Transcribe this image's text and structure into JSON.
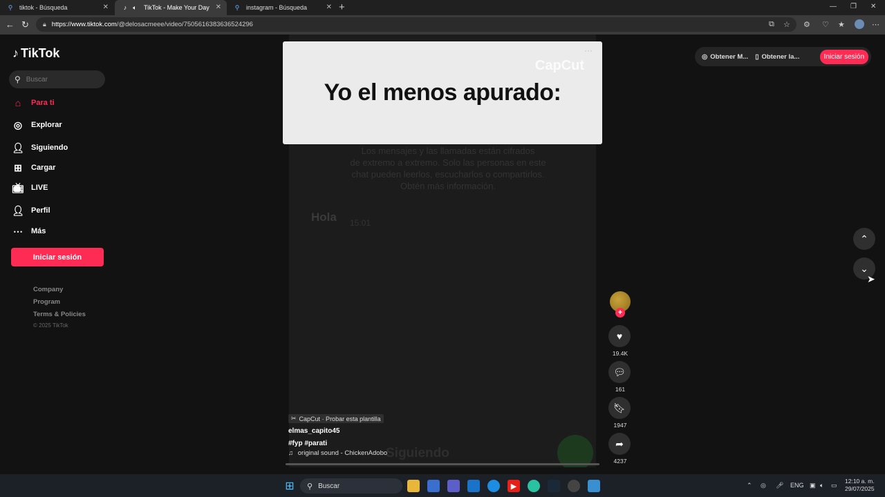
{
  "browser": {
    "tabs": [
      {
        "title": "tiktok - Búsqueda",
        "icon": "search-icon",
        "active": false
      },
      {
        "title": "TikTok - Make Your Day",
        "icon": "tiktok-icon",
        "active": true
      },
      {
        "title": "instagram - Búsqueda",
        "icon": "search-icon",
        "active": false
      }
    ],
    "url_domain": "https://www.tiktok.com",
    "url_path": "/@delosacmeee/video/7505616383636524296"
  },
  "sidebar": {
    "logo": "TikTok",
    "search_placeholder": "Buscar",
    "nav": [
      {
        "label": "Para ti",
        "icon": "home-icon",
        "active": true
      },
      {
        "label": "Explorar",
        "icon": "compass-icon",
        "active": false
      },
      {
        "label": "Siguiendo",
        "icon": "following-icon",
        "active": false
      },
      {
        "label": "Cargar",
        "icon": "upload-icon",
        "active": false
      },
      {
        "label": "LIVE",
        "icon": "live-icon",
        "active": false
      },
      {
        "label": "Perfil",
        "icon": "profile-icon",
        "active": false
      },
      {
        "label": "Más",
        "icon": "more-icon",
        "active": false
      }
    ],
    "login_button": "Iniciar sesión",
    "footer_links": [
      "Company",
      "Program",
      "Terms & Policies"
    ],
    "copyright": "© 2025 TikTok"
  },
  "topbar": {
    "get_app_1": "Obtener M...",
    "get_app_2": "Obtener la...",
    "login": "Iniciar sesión"
  },
  "video": {
    "overlay_caption": "Yo el menos apurado:",
    "watermark": "CapCut",
    "background_text": [
      "Los mensajes y las llamadas están cifrados",
      "de extremo a extremo. Solo las personas en este",
      "chat pueden leerlos, escucharlos o compartirlos.",
      "Obtén más información."
    ],
    "bubble_text": "Hola",
    "bubble_time": "15:01",
    "bottom_blur_text": "Siguiendo",
    "capcut_tag": "CapCut · Probar esta plantilla",
    "author": "elmas_capito45",
    "hashtags": "#fyp  #parati",
    "sound": "original sound - ChickenAdobo"
  },
  "actions": {
    "likes": "19.4K",
    "comments": "161",
    "saves": "1947",
    "shares": "4237"
  },
  "taskbar": {
    "search": "Buscar",
    "lang": "ENG",
    "time": "12:10 a. m.",
    "date": "29/07/2025"
  },
  "colors": {
    "accent": "#fe2c55",
    "background": "#121212"
  }
}
